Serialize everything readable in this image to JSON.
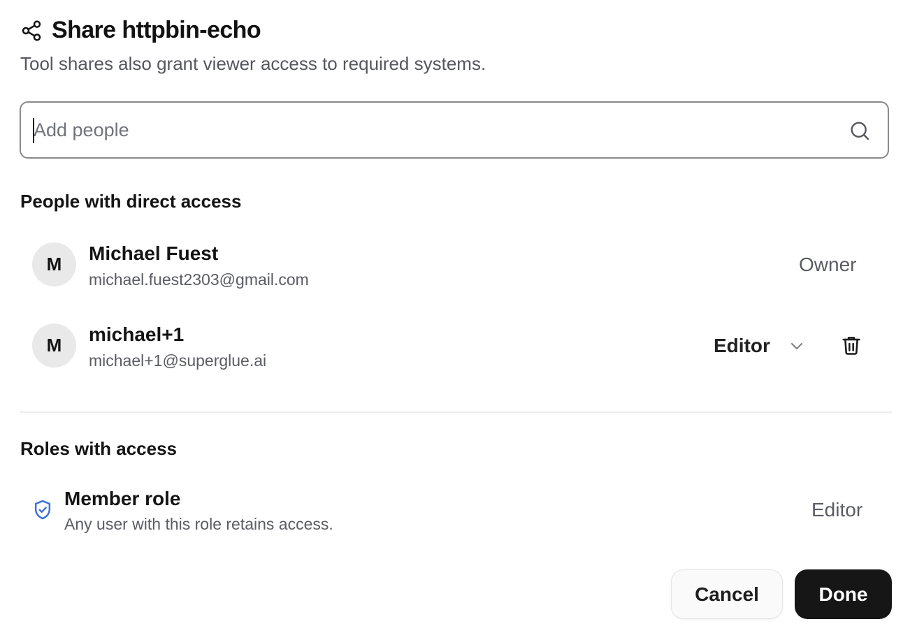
{
  "dialog": {
    "title": "Share httpbin-echo",
    "subtitle": "Tool shares also grant viewer access to required systems."
  },
  "search": {
    "placeholder": "Add people",
    "value": "",
    "icon": "search-icon"
  },
  "people_section": {
    "title": "People with direct access",
    "people": [
      {
        "initial": "M",
        "name": "Michael Fuest",
        "email": "michael.fuest2303@gmail.com",
        "role": "Owner",
        "editable": false
      },
      {
        "initial": "M",
        "name": "michael+1",
        "email": "michael+1@superglue.ai",
        "role": "Editor",
        "editable": true
      }
    ]
  },
  "roles_section": {
    "title": "Roles with access",
    "roles": [
      {
        "name": "Member role",
        "description": "Any user with this role retains access.",
        "access": "Editor",
        "icon": "shield-check-icon"
      }
    ]
  },
  "buttons": {
    "cancel": "Cancel",
    "done": "Done"
  },
  "colors": {
    "primary_button": "#161616",
    "shield_accent": "#3b6fd9",
    "avatar_bg": "#e9e9e9",
    "muted_text": "#5a5c62"
  }
}
